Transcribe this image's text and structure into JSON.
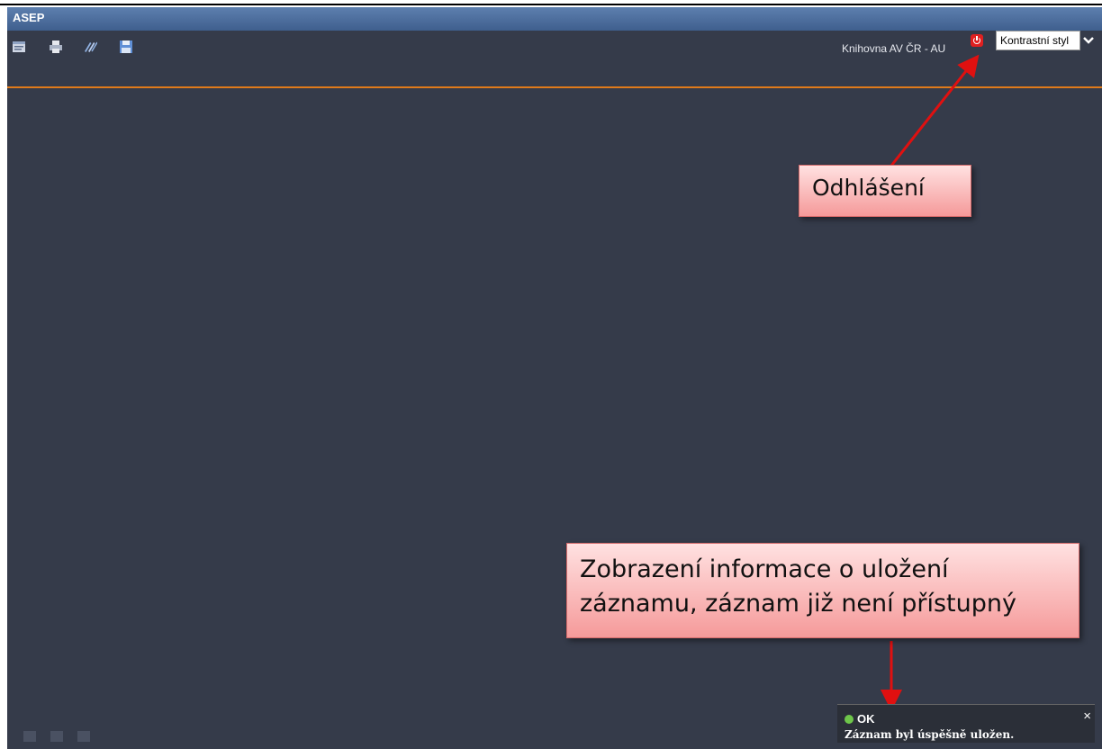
{
  "app": {
    "title": "ASEP"
  },
  "toolbar": {
    "icons": [
      "window-icon",
      "print-icon",
      "edit-icon",
      "save-icon"
    ],
    "library": "Knihovna AV ČR - AU",
    "style_select": "Kontrastní styl"
  },
  "annotations": {
    "logout": "Odhlášení",
    "save_info_line1": "Zobrazení informace o uložení",
    "save_info_line2": "záznamu, záznam již není přístupný"
  },
  "notification": {
    "status": "OK",
    "close": "×",
    "message": "Záznam byl úspěšně uložen."
  },
  "colors": {
    "background": "#353b4a",
    "accent": "#e07a1a",
    "arrow": "#e01010",
    "callout": "#f59a9a"
  }
}
